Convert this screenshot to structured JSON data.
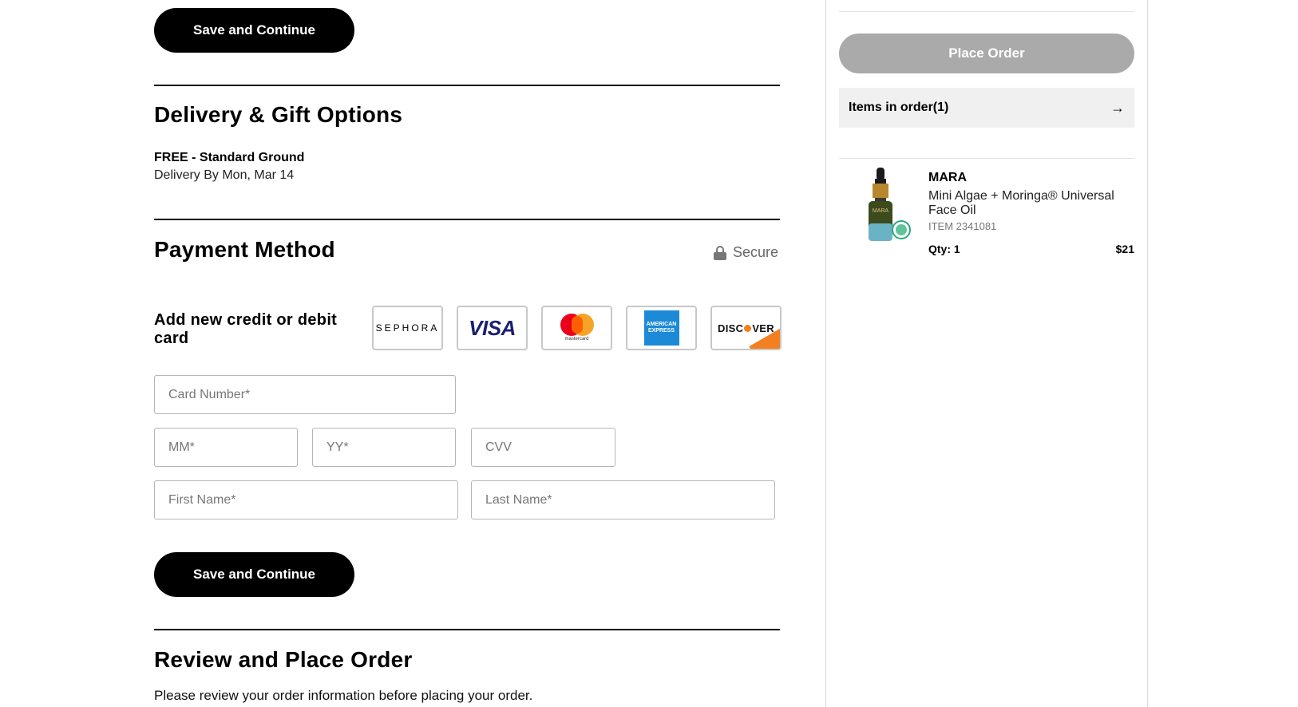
{
  "checkout": {
    "save_continue_top": "Save and Continue",
    "delivery": {
      "heading": "Delivery & Gift Options",
      "method": "FREE - Standard Ground",
      "eta": "Delivery By Mon, Mar 14"
    },
    "payment": {
      "heading": "Payment Method",
      "secure_label": "Secure",
      "add_card_label": "Add new credit or debit card",
      "card_brands": [
        "SEPHORA",
        "VISA",
        "mastercard",
        "AMERICAN EXPRESS",
        "DISCOVER"
      ],
      "fields": {
        "card_number": "Card Number*",
        "mm": "MM*",
        "yy": "YY*",
        "cvv": "CVV",
        "first_name": "First Name*",
        "last_name": "Last Name*"
      },
      "save_continue": "Save and Continue"
    },
    "review": {
      "heading": "Review and Place Order",
      "text": "Please review your order information before placing your order."
    }
  },
  "sidebar": {
    "place_order": "Place Order",
    "items_in_order": "Items in order(1)",
    "product": {
      "brand": "MARA",
      "name": "Mini Algae + Moringa® Universal Face Oil",
      "item_number": "ITEM 2341081",
      "qty": "Qty: 1",
      "price": "$21",
      "image_label": "MARA"
    }
  },
  "colors": {
    "primary_button": "#000000",
    "disabled_button": "#aaaaaa",
    "items_bar_bg": "#f0f0f0"
  }
}
